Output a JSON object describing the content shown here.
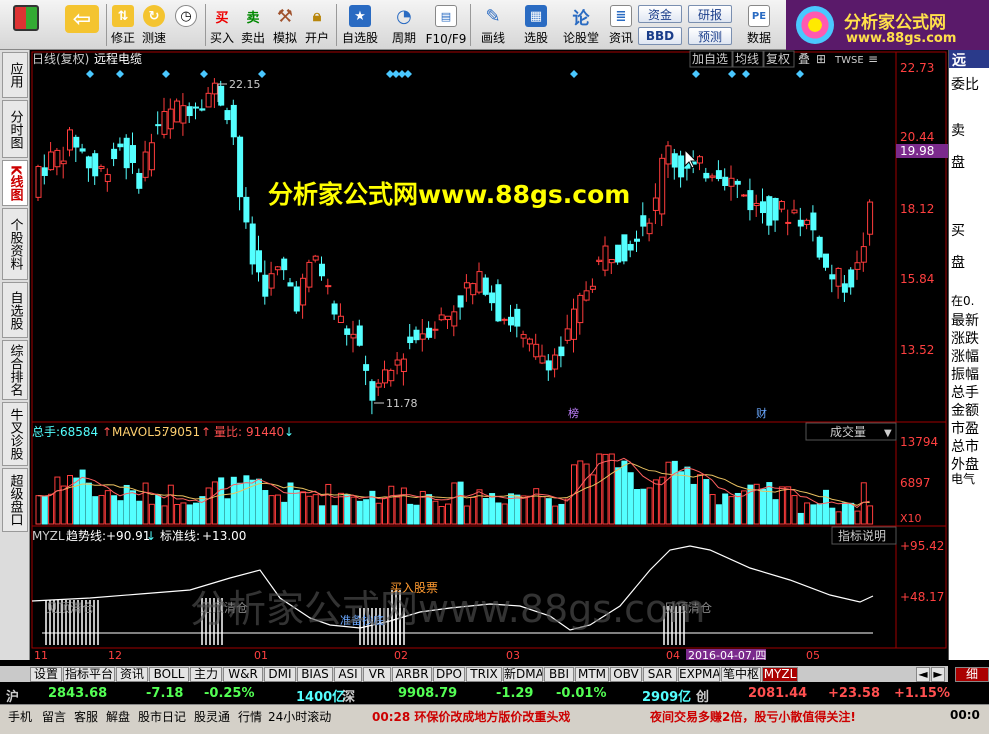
{
  "toolbar": {
    "buttons": [
      {
        "label": "",
        "icon": "grid-icon"
      },
      {
        "label": "",
        "icon": "back-arrow-icon"
      },
      {
        "label": "修正",
        "icon": "updown-arrow-icon"
      },
      {
        "label": "测速",
        "icon": "speed-icon"
      },
      {
        "label": "买入",
        "icon": "buy-icon",
        "glyph": "买"
      },
      {
        "label": "卖出",
        "icon": "sell-icon",
        "glyph": "卖"
      },
      {
        "label": "模拟",
        "icon": "hammer-icon"
      },
      {
        "label": "开户",
        "icon": "lock-icon"
      },
      {
        "label": "自选股",
        "icon": "star-icon"
      },
      {
        "label": "周期",
        "icon": "clock-icon"
      },
      {
        "label": "F10/F9",
        "icon": "f10-icon"
      },
      {
        "label": "画线",
        "icon": "pen-icon"
      },
      {
        "label": "选股",
        "icon": "select-icon"
      },
      {
        "label": "论股堂",
        "icon": "forum-icon",
        "glyph": "论"
      },
      {
        "label": "资讯",
        "icon": "info-icon"
      },
      {
        "label": "数据",
        "icon": "pe-icon",
        "glyph": "PE"
      }
    ],
    "small_buttons": [
      "资金",
      "BBD",
      "研报",
      "预测"
    ],
    "logo_title": "分析家公式网",
    "logo_url": "www.88gs.com"
  },
  "left_tabs": [
    "应用",
    "分时图",
    "K线图",
    "个股资料",
    "自选股",
    "综合排名",
    "牛叉诊股",
    "超级盘口"
  ],
  "chart": {
    "title": "日线(复权)",
    "stock": "远程电缆",
    "top_buttons": [
      "加自选",
      "均线",
      "复权",
      "叠",
      "⊞",
      "TWSE",
      "≡"
    ],
    "price_axis": [
      "22.73",
      "20.44",
      "19.98",
      "18.12",
      "15.84",
      "13.52"
    ],
    "high_label": "22.15",
    "low_label": "11.78",
    "watermark": "分析家公式网www.88gs.com",
    "event_tags": [
      "榜",
      "财"
    ],
    "volume_indicators": {
      "zongshou_label": "总手:",
      "zongshou_value": "68584",
      "mavol_label": "MAVOL5:",
      "mavol_value": "79051",
      "liangbi_label": "量比:",
      "liangbi_value": "91440"
    },
    "volume_dropdown": "成交量",
    "volume_axis": [
      "13794",
      "6897",
      "X10"
    ],
    "myzl": {
      "name": "MYZL",
      "trend_label": "趋势线:",
      "trend_value": "+90.91",
      "std_label": "标准线:",
      "std_value": "+13.00",
      "explain_button": "指标说明",
      "axis": [
        "+95.42",
        "+48.17"
      ],
      "signals": [
        "见顶清仓",
        "见顶清仓",
        "准备抄底",
        "买入股票",
        "见顶清仓"
      ]
    },
    "date_axis": [
      "11",
      "12",
      "01",
      "02",
      "03",
      "04",
      "05"
    ],
    "date_highlight": "2016-04-07,四"
  },
  "bottom_tabs": [
    "设置",
    "指标平台",
    "资讯",
    "BOLL",
    "主力",
    "W&R",
    "DMI",
    "BIAS",
    "ASI",
    "VR",
    "ARBR",
    "DPO",
    "TRIX",
    "新DMA",
    "BBI",
    "MTM",
    "OBV",
    "SAR",
    "EXPMA",
    "笔中枢",
    "MYZL"
  ],
  "bottom_right_buttons": [
    "◄",
    "►",
    "细"
  ],
  "index_bar": {
    "sh_label": "沪",
    "sh_value": "2843.68",
    "sh_change": "-7.18",
    "sh_pct": "-0.25%",
    "sh_amount": "1400亿",
    "sz_label": "深",
    "sz_value": "9908.79",
    "sz_change": "-1.29",
    "sz_pct": "-0.01%",
    "sz_amount": "2909亿",
    "cy_label": "创",
    "cy_value": "2081.44",
    "cy_change": "+23.58",
    "cy_pct": "+1.15%"
  },
  "status_bar": {
    "items": [
      "手机",
      "留言",
      "客服",
      "解盘",
      "股市日记",
      "股灵通",
      "行情",
      "24小时滚动"
    ],
    "news1": "00:28 环保价改成地方版价改重头戏",
    "news2": "夜间交易多赚2倍，股亏小散值得关注!",
    "clock": "00:0"
  },
  "right_panel": [
    "远",
    "委比",
    "卖",
    "盘",
    "买",
    "盘",
    "在0.",
    "最新",
    "涨跌",
    "涨幅",
    "振幅",
    "总手",
    "金额",
    "市盈",
    "总市",
    "外盘",
    "电气"
  ],
  "colors": {
    "up": "#ff3c3c",
    "down": "#54ffff",
    "accent": "#7b2a8c",
    "yellow": "#ffff00"
  },
  "chart_data": {
    "type": "candlestick",
    "dates_range": [
      "2015-11",
      "2016-05"
    ],
    "price_high": 22.15,
    "price_low": 11.78,
    "current_price": 19.98,
    "volume_max": 13794,
    "myzl_max": 95.42,
    "myzl_mid": 48.17
  }
}
